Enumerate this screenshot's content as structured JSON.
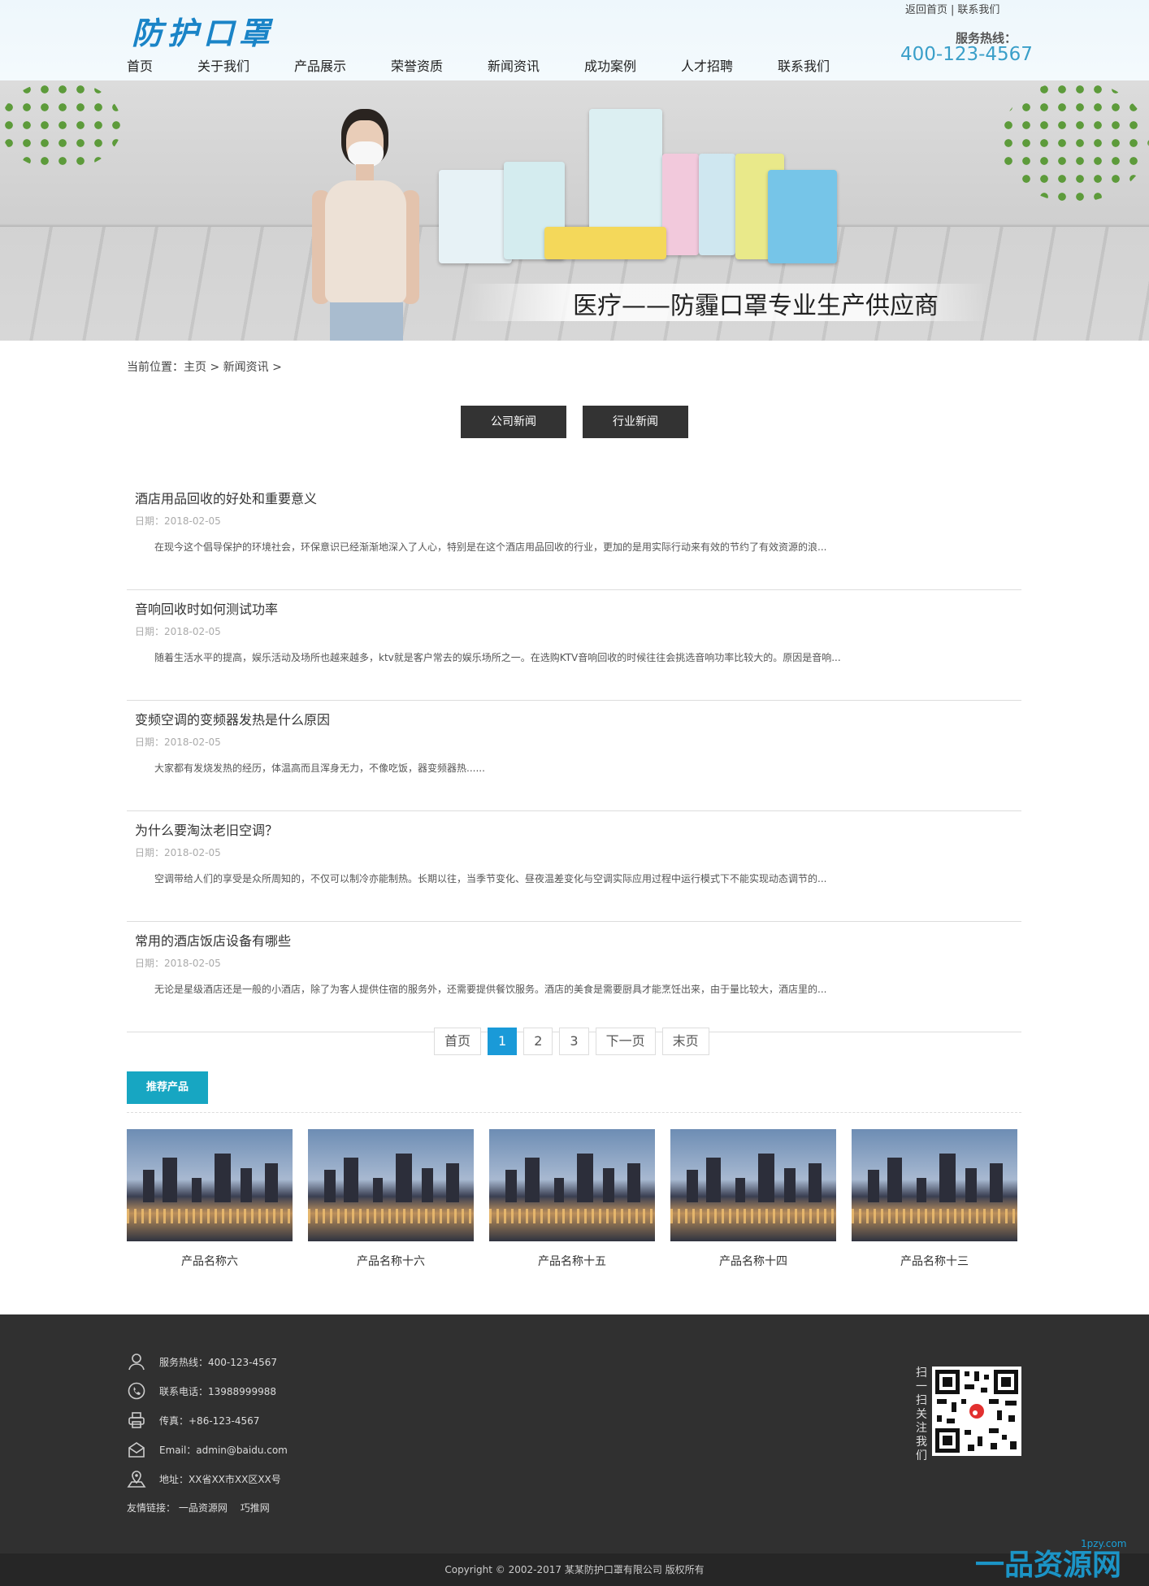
{
  "header": {
    "logo_text": "防护口罩",
    "top_links": [
      "返回首页",
      "联系我们"
    ],
    "hotline_label": "服务热线：",
    "hotline_number": "400-123-4567"
  },
  "nav": [
    "首页",
    "关于我们",
    "产品展示",
    "荣誉资质",
    "新闻资讯",
    "成功案例",
    "人才招聘",
    "联系我们"
  ],
  "banner": {
    "slogan": "医疗——防霾口罩专业生产供应商"
  },
  "breadcrumb": "当前位置：主页 > 新闻资讯 >",
  "tabs": [
    "公司新闻",
    "行业新闻"
  ],
  "news": [
    {
      "title": "酒店用品回收的好处和重要意义",
      "date": "日期：2018-02-05",
      "summary": "在现今这个倡导保护的环境社会，环保意识已经渐渐地深入了人心，特别是在这个酒店用品回收的行业，更加的是用实际行动来有效的节约了有效资源的浪..."
    },
    {
      "title": "音响回收时如何测试功率",
      "date": "日期：2018-02-05",
      "summary": "随着生活水平的提高，娱乐活动及场所也越来越多，ktv就是客户常去的娱乐场所之一。在选购KTV音响回收的时候往往会挑选音响功率比较大的。原因是音响..."
    },
    {
      "title": "变频空调的变频器发热是什么原因",
      "date": "日期：2018-02-05",
      "summary": "大家都有发烧发热的经历，体温高而且浑身无力，不像吃饭，器变频器热......"
    },
    {
      "title": "为什么要淘汰老旧空调？",
      "date": "日期：2018-02-05",
      "summary": "空调带给人们的享受是众所周知的，不仅可以制冷亦能制热。长期以往，当季节变化、昼夜温差变化与空调实际应用过程中运行模式下不能实现动态调节的..."
    },
    {
      "title": "常用的酒店饭店设备有哪些",
      "date": "日期：2018-02-05",
      "summary": "无论是星级酒店还是一般的小酒店，除了为客人提供住宿的服务外，还需要提供餐饮服务。酒店的美食是需要厨具才能烹饪出来，由于量比较大，酒店里的..."
    }
  ],
  "pager": {
    "first": "首页",
    "pages": [
      "1",
      "2",
      "3"
    ],
    "current": "1",
    "next": "下一页",
    "last": "末页"
  },
  "recommend": {
    "title": "推荐产品",
    "products": [
      "产品名称六",
      "产品名称十六",
      "产品名称十五",
      "产品名称十四",
      "产品名称十三"
    ]
  },
  "footer": {
    "rows": [
      {
        "icon": "user-icon",
        "text": "服务热线：400-123-4567"
      },
      {
        "icon": "phone-icon",
        "text": "联系电话：13988999988"
      },
      {
        "icon": "printer-icon",
        "text": "传真：+86-123-4567"
      },
      {
        "icon": "mail-icon",
        "text": "Email：admin@baidu.com"
      },
      {
        "icon": "location-icon",
        "text": "地址：XX省XX市XX区XX号"
      }
    ],
    "links_label": "友情链接：",
    "links": [
      "一品资源网",
      "巧推网"
    ],
    "qr_label": "扫一扫关注我们",
    "copyright": "Copyright © 2002-2017 某某防护口罩有限公司 版权所有"
  },
  "watermark": {
    "text": "一品资源网",
    "domain": "1pzy.com"
  },
  "colors": {
    "accent": "#17a6c2",
    "pager_active": "#1a9ad8",
    "hotline": "#3a9fc9",
    "footer_bg": "#303030"
  }
}
